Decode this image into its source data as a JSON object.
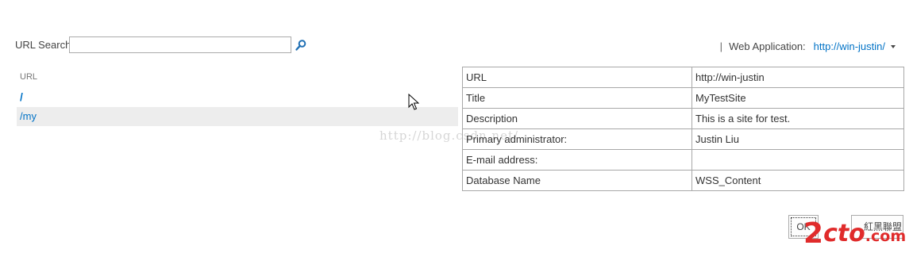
{
  "search": {
    "label": "URL Search",
    "value": "",
    "button_icon": "magnifier-icon"
  },
  "web_application": {
    "separator": "|",
    "label": "Web Application:",
    "value": "http://win-justin/"
  },
  "url_list": {
    "header": "URL",
    "items": [
      {
        "label": "/"
      },
      {
        "label": "/my",
        "selected": true
      }
    ]
  },
  "properties": [
    {
      "key": "URL",
      "value": "http://win-justin"
    },
    {
      "key": "Title",
      "value": "MyTestSite"
    },
    {
      "key": "Description",
      "value": "This is a site for test."
    },
    {
      "key": "Primary administrator:",
      "value": "Justin Liu"
    },
    {
      "key": "E-mail address:",
      "value": ""
    },
    {
      "key": "Database Name",
      "value": "WSS_Content"
    }
  ],
  "buttons": {
    "ok": "OK",
    "cancel": "紅黑聯盟"
  },
  "watermark": "http://blog.csdn.net/",
  "logo": {
    "part1": "2",
    "part2": "cto",
    "part3": ".com"
  },
  "colors": {
    "link": "#0072c6",
    "selected_row": "#ededed",
    "border": "#a8a8a8",
    "logo": "#e02b2b"
  }
}
